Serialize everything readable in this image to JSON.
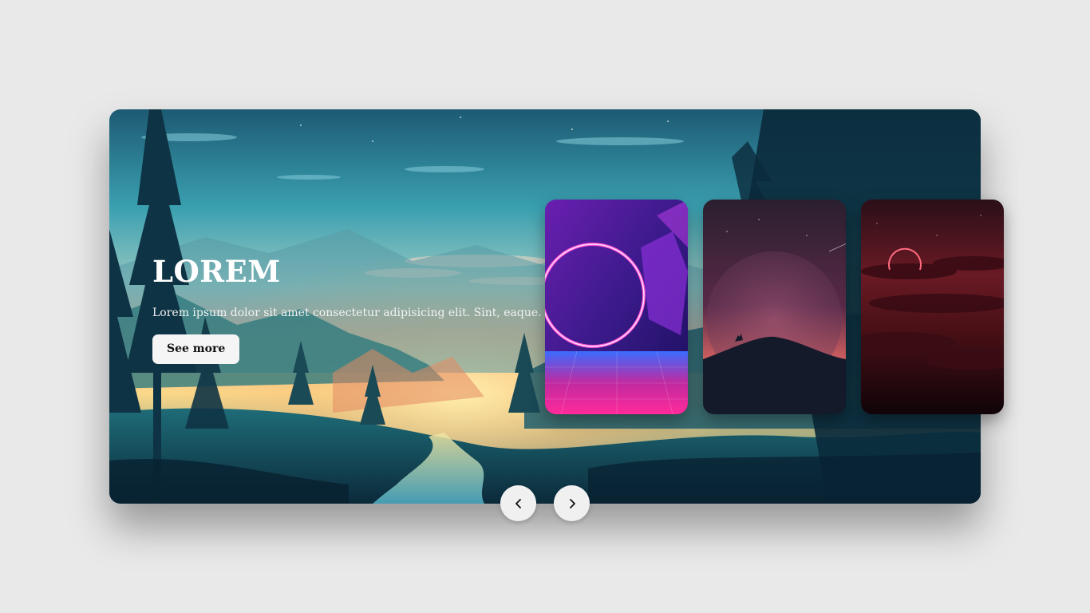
{
  "hero": {
    "title": "LOREM",
    "description": "Lorem ipsum dolor sit amet consectetur adipisicing elit. Sint, eaque.",
    "button_label": "See more",
    "image": "forest-valley-sunset-landscape"
  },
  "cards": [
    {
      "image": "neon-ring-synthwave"
    },
    {
      "image": "wolf-on-hill-under-moon"
    },
    {
      "image": "red-eclipse-over-clouds"
    }
  ],
  "navigation": {
    "prev_icon": "chevron-left-icon",
    "next_icon": "chevron-right-icon"
  },
  "colors": {
    "page_background": "#e9e9e9",
    "button_background": "#f5f5f5",
    "text_light": "#ffffff"
  }
}
